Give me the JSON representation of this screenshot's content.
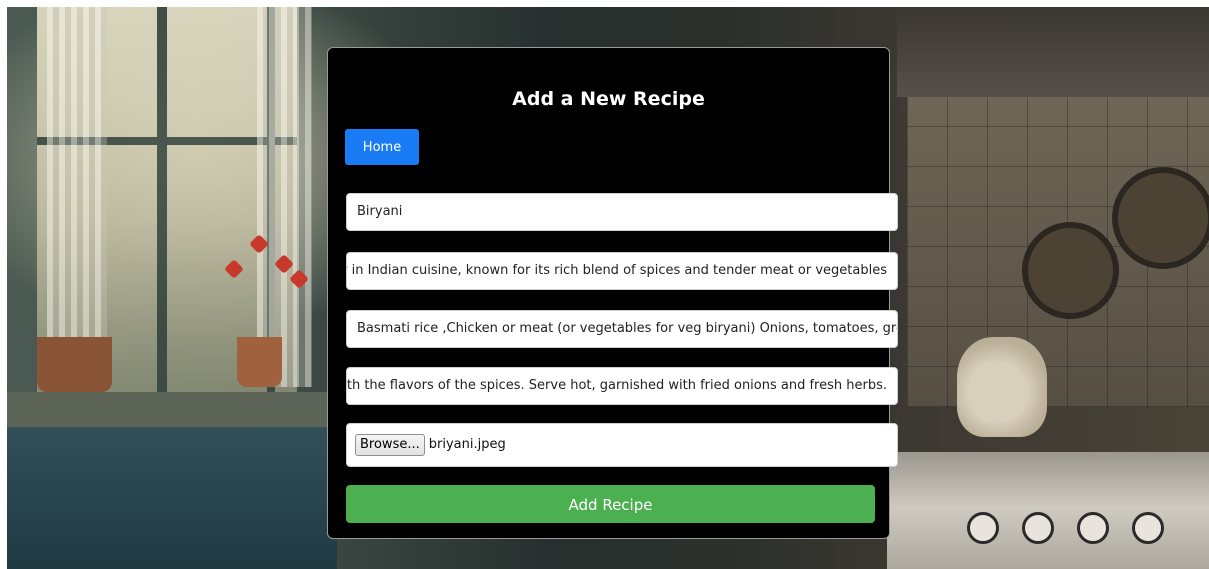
{
  "form": {
    "title": "Add a New Recipe",
    "home_label": "Home",
    "name_value": "Biryani",
    "description_value": "ar in Indian cuisine, known for its rich blend of spices and tender meat or vegetables",
    "ingredients_value": "Basmati rice ,Chicken or meat (or vegetables for veg biryani) Onions, tomatoes, gree",
    "instructions_value": "with the flavors of the spices. Serve hot, garnished with fried onions and fresh herbs.",
    "browse_label": "Browse...",
    "file_name": "briyani.jpeg",
    "submit_label": "Add Recipe"
  },
  "colors": {
    "card_bg": "#000000",
    "home_button": "#1a7cf4",
    "submit_button": "#4caf50"
  }
}
